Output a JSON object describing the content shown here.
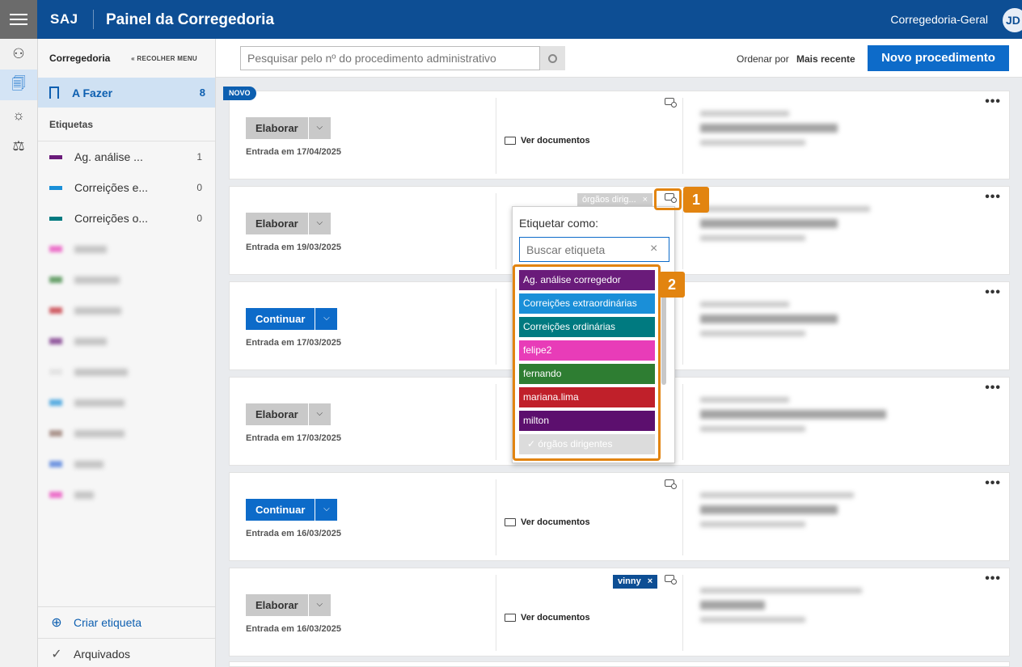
{
  "header": {
    "brand": "SAJ",
    "title": "Painel da Corregedoria",
    "user": "Corregedoria-Geral",
    "avatar": "JD"
  },
  "sidebar": {
    "title": "Corregedoria",
    "collapse": "« RECOLHER MENU",
    "todo": {
      "label": "A Fazer",
      "count": "8"
    },
    "section": "Etiquetas",
    "tags": [
      {
        "label": "Ag. análise ...",
        "count": "1",
        "color": "#6a1b7a"
      },
      {
        "label": "Correições e...",
        "count": "0",
        "color": "#1a8fd8"
      },
      {
        "label": "Correições o...",
        "count": "0",
        "color": "#007a80"
      }
    ],
    "create": "Criar etiqueta",
    "archived": "Arquivados"
  },
  "toolbar": {
    "search_placeholder": "Pesquisar pelo nº do procedimento administrativo",
    "order_label": "Ordenar por",
    "order_value": "Mais recente",
    "new_button": "Novo procedimento"
  },
  "cards": [
    {
      "badge": "NOVO",
      "action": "Elaborar",
      "caret": "⌵",
      "date": "Entrada em 17/04/2025",
      "docs": "Ver documentos",
      "more": "•••"
    },
    {
      "action": "Elaborar",
      "caret": "⌵",
      "date": "Entrada em 19/03/2025",
      "chip": "órgãos dirig...",
      "chip_x": "×",
      "more": "•••"
    },
    {
      "action": "Continuar",
      "caret": "⌵",
      "date": "Entrada em 17/03/2025",
      "more": "•••"
    },
    {
      "action": "Elaborar",
      "caret": "⌵",
      "date": "Entrada em 17/03/2025",
      "more": "•••"
    },
    {
      "action": "Continuar",
      "caret": "⌵",
      "date": "Entrada em 16/03/2025",
      "docs": "Ver documentos",
      "more": "•••"
    },
    {
      "action": "Elaborar",
      "caret": "⌵",
      "date": "Entrada em 16/03/2025",
      "docs": "Ver documentos",
      "chip": "vinny",
      "chip_x": "×",
      "more": "•••"
    }
  ],
  "dropdown": {
    "title": "Etiquetar como:",
    "placeholder": "Buscar etiqueta",
    "clear": "×",
    "items": [
      {
        "label": "Ag. análise corregedor",
        "color": "#6a1b7a"
      },
      {
        "label": "Correições extraordinárias",
        "color": "#1a8fd8"
      },
      {
        "label": "Correições ordinárias",
        "color": "#007a80"
      },
      {
        "label": "felipe2",
        "color": "#e83cb8"
      },
      {
        "label": "fernando",
        "color": "#2e7d32"
      },
      {
        "label": "mariana.lima",
        "color": "#c0202a"
      },
      {
        "label": "milton",
        "color": "#5c0f6e"
      },
      {
        "label": "✓  órgãos dirigentes",
        "color": "#dcdcdc"
      }
    ]
  },
  "annotations": {
    "one": "1",
    "two": "2"
  }
}
